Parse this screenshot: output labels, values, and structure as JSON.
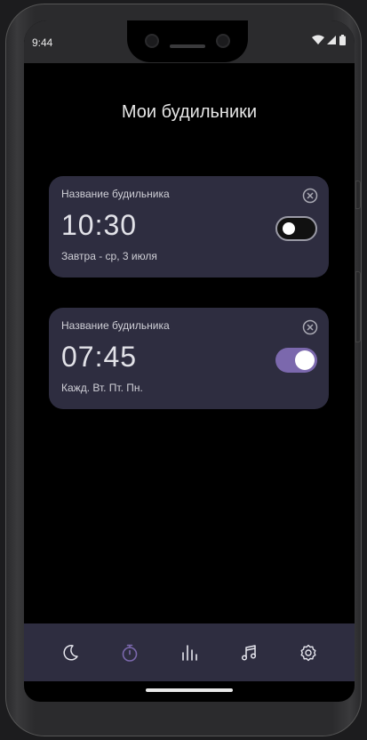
{
  "status": {
    "time": "9:44"
  },
  "page": {
    "title": "Мои будильники"
  },
  "alarms": [
    {
      "name": "Название будильника",
      "time": "10:30",
      "subtitle": "Завтра - ср, 3 июля",
      "enabled": false
    },
    {
      "name": "Название будильника",
      "time": "07:45",
      "subtitle": "Кажд. Вт. Пт. Пн.",
      "enabled": true
    }
  ],
  "nav": {
    "items": [
      {
        "icon": "moon-icon",
        "active": false
      },
      {
        "icon": "stopwatch-icon",
        "active": true
      },
      {
        "icon": "bar-chart-icon",
        "active": false
      },
      {
        "icon": "music-note-icon",
        "active": false
      },
      {
        "icon": "gear-icon",
        "active": false
      }
    ]
  },
  "colors": {
    "card_bg": "#2e2d40",
    "accent": "#7b68ad",
    "background": "#000000"
  }
}
